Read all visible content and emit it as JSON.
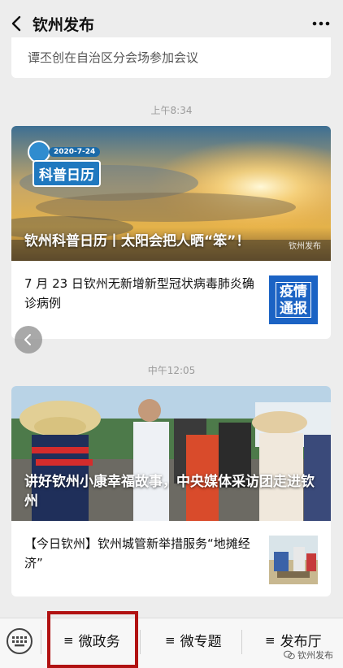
{
  "header": {
    "title": "钦州发布"
  },
  "prev_article": {
    "text": "谭丕创在自治区分会场参加会议"
  },
  "feed": [
    {
      "time": "上午8:34",
      "hero": {
        "title": "钦州科普日历丨太阳会把人晒“笨”！",
        "badge_date": "2020-7-24",
        "badge_text": "科普日历",
        "watermark": "钦州发布"
      },
      "item": {
        "text": "7 月 23 日钦州无新增新型冠状病毒肺炎确诊病例",
        "thumb_text": "疫情通报"
      }
    },
    {
      "time": "中午12:05",
      "hero": {
        "title": "讲好钦州小康幸福故事，中央媒体采访团走进钦州"
      },
      "item": {
        "text": "【今日钦州】钦州城管新举措服务“地摊经济”"
      }
    }
  ],
  "bottom_menu": {
    "items": [
      {
        "label": "微政务"
      },
      {
        "label": "微专题"
      },
      {
        "label": "发布厅"
      }
    ],
    "watermark": "钦州发布"
  },
  "colors": {
    "highlight": "#b11212",
    "background": "#ededed"
  }
}
